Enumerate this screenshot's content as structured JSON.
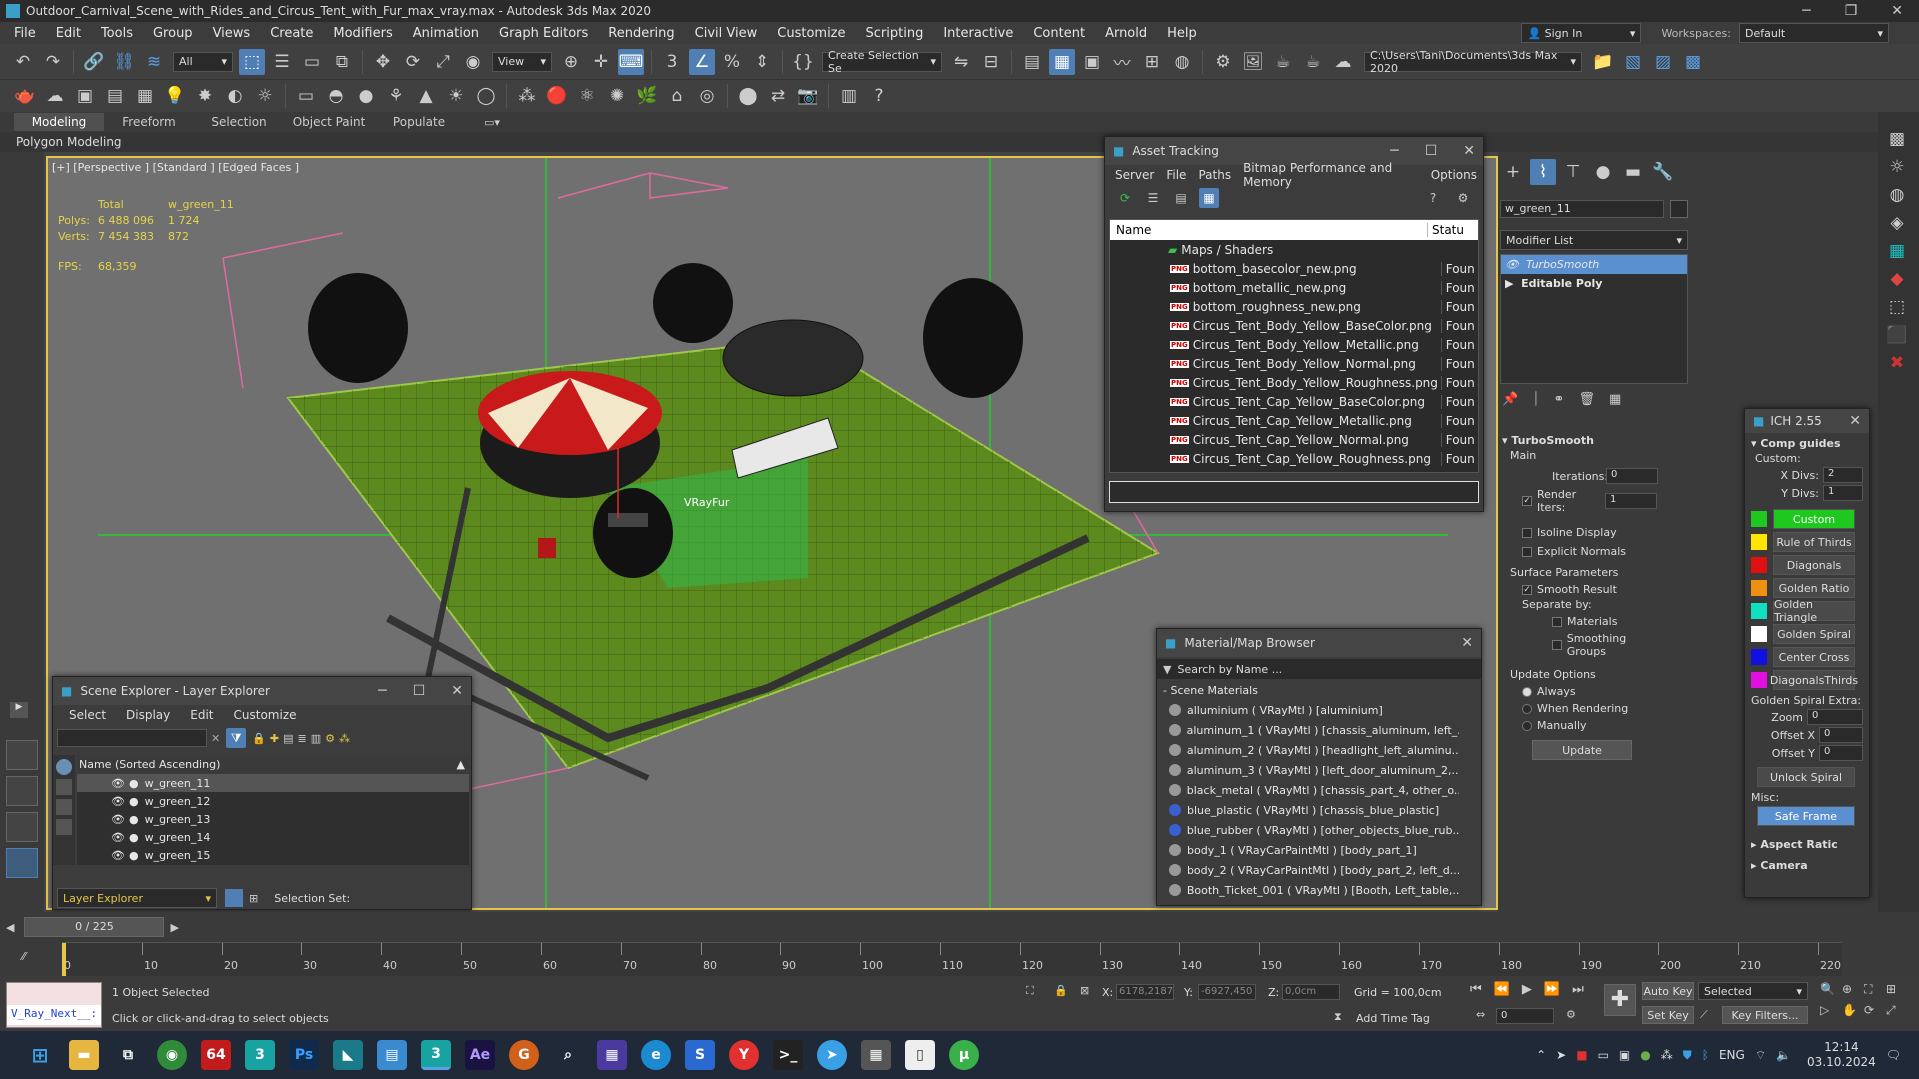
{
  "window": {
    "title": "Outdoor_Carnival_Scene_with_Rides_and_Circus_Tent_with_Fur_max_vray.max - Autodesk 3ds Max 2020"
  },
  "menu": [
    "File",
    "Edit",
    "Tools",
    "Group",
    "Views",
    "Create",
    "Modifiers",
    "Animation",
    "Graph Editors",
    "Rendering",
    "Civil View",
    "Customize",
    "Scripting",
    "Interactive",
    "Content",
    "Arnold",
    "Help"
  ],
  "account": {
    "sign_in": "Sign In",
    "workspaces_label": "Workspaces:",
    "workspace": "Default"
  },
  "toolbar": {
    "filter": "All",
    "ref_coord": "View",
    "selection_set": "Create Selection Se",
    "project_path": "C:\\Users\\Tani\\Documents\\3ds Max 2020"
  },
  "ribbon": {
    "tabs": [
      "Modeling",
      "Freeform",
      "Selection",
      "Object Paint",
      "Populate"
    ],
    "sub": "Polygon Modeling"
  },
  "viewport": {
    "label": "[+] [Perspective ] [Standard ] [Edged Faces ]",
    "stats": {
      "total_label": "Total",
      "object_label": "w_green_11",
      "polys_label": "Polys:",
      "polys_total": "6 488 096",
      "polys_obj": "1 724",
      "verts_label": "Verts:",
      "verts_total": "7 454 383",
      "verts_obj": "872",
      "fps_label": "FPS:",
      "fps": "68,359"
    },
    "vrayfur_label": "VRayFur"
  },
  "asset_tracking": {
    "title": "Asset Tracking",
    "menu": [
      "Server",
      "File",
      "Paths",
      "Bitmap Performance and Memory",
      "Options"
    ],
    "col_name": "Name",
    "col_status": "Statu",
    "group": "Maps / Shaders",
    "files": [
      "bottom_basecolor_new.png",
      "bottom_metallic_new.png",
      "bottom_roughness_new.png",
      "Circus_Tent_Body_Yellow_BaseColor.png",
      "Circus_Tent_Body_Yellow_Metallic.png",
      "Circus_Tent_Body_Yellow_Normal.png",
      "Circus_Tent_Body_Yellow_Roughness.png",
      "Circus_Tent_Cap_Yellow_BaseColor.png",
      "Circus_Tent_Cap_Yellow_Metallic.png",
      "Circus_Tent_Cap_Yellow_Normal.png",
      "Circus_Tent_Cap_Yellow_Roughness.png"
    ],
    "status": "Foun"
  },
  "material_browser": {
    "title": "Material/Map Browser",
    "search_placeholder": "Search by Name ...",
    "section": "Scene Materials",
    "items": [
      "alluminium ( VRayMtl ) [aluminium]",
      "aluminum_1 ( VRayMtl ) [chassis_aluminum, left_...",
      "aluminum_2 ( VRayMtl ) [headlight_left_aluminu...",
      "aluminum_3 ( VRayMtl ) [left_door_aluminum_2,...",
      "black_metal ( VRayMtl ) [chassis_part_4, other_o...",
      "blue_plastic ( VRayMtl ) [chassis_blue_plastic]",
      "blue_rubber ( VRayMtl ) [other_objects_blue_rub...",
      "body_1 ( VRayCarPaintMtl ) [body_part_1]",
      "body_2 ( VRayCarPaintMtl ) [body_part_2, left_d...",
      "Booth_Ticket_001 ( VRayMtl ) [Booth, Left_table,..."
    ]
  },
  "scene_explorer": {
    "title": "Scene Explorer - Layer Explorer",
    "menu": [
      "Select",
      "Display",
      "Edit",
      "Customize"
    ],
    "column": "Name (Sorted Ascending)",
    "rows": [
      "w_green_11",
      "w_green_12",
      "w_green_13",
      "w_green_14",
      "w_green_15"
    ],
    "footer_mode": "Layer Explorer",
    "selection_set": "Selection Set:"
  },
  "modify_panel": {
    "object_name": "w_green_11",
    "modifier_list": "Modifier List",
    "stack": [
      "TurboSmooth",
      "Editable Poly"
    ],
    "turbosmooth": {
      "title": "TurboSmooth",
      "main": "Main",
      "iterations_label": "Iterations:",
      "iterations": "0",
      "render_iters_label": "Render Iters:",
      "render_iters": "1",
      "isoline": "Isoline Display",
      "explicit": "Explicit Normals",
      "surface": "Surface Parameters",
      "smooth_result": "Smooth Result",
      "separate_by": "Separate by:",
      "materials": "Materials",
      "smoothing_groups": "Smoothing Groups",
      "update_options": "Update Options",
      "always": "Always",
      "when_rendering": "When Rendering",
      "manually": "Manually",
      "update_button": "Update"
    }
  },
  "ich": {
    "title": "ICH 2.55",
    "comp_guides": "Comp guides",
    "custom_label": "Custom:",
    "xdivs_label": "X Divs:",
    "xdivs": "2",
    "ydivs_label": "Y Divs:",
    "ydivs": "1",
    "guides": [
      {
        "name": "Custom",
        "color": "#1ec81e"
      },
      {
        "name": "Rule of Thirds",
        "color": "#ffe600"
      },
      {
        "name": "Diagonals",
        "color": "#e01010"
      },
      {
        "name": "Golden Ratio",
        "color": "#f09010"
      },
      {
        "name": "Golden Triangle",
        "color": "#10e0c0"
      },
      {
        "name": "Golden Spiral",
        "color": "#ffffff"
      },
      {
        "name": "Center Cross",
        "color": "#1010e0"
      },
      {
        "name": "DiagonalsThirds",
        "color": "#e010e0"
      }
    ],
    "spiral_extra": "Golden Spiral Extra:",
    "zoom_label": "Zoom",
    "zoom": "0",
    "offx_label": "Offset X",
    "offx": "0",
    "offy_label": "Offset Y",
    "offy": "0",
    "unlock": "Unlock Spiral",
    "misc": "Misc:",
    "safe_frame": "Safe Frame",
    "aspect": "Aspect Ratic",
    "camera": "Camera"
  },
  "timeline": {
    "frame": "0 / 225",
    "ticks": [
      "0",
      "10",
      "20",
      "30",
      "40",
      "50",
      "60",
      "70",
      "80",
      "90",
      "100",
      "110",
      "120",
      "130",
      "140",
      "150",
      "160",
      "170",
      "180",
      "190",
      "200",
      "210",
      "220"
    ]
  },
  "status": {
    "maxscript": "V_Ray_Next__:",
    "selected": "1 Object Selected",
    "prompt": "Click or click-and-drag to select objects",
    "x_label": "X:",
    "x": "6178,2187",
    "y_label": "Y:",
    "y": "-6927,450",
    "z_label": "Z:",
    "z": "0,0cm",
    "grid": "Grid = 100,0cm",
    "add_time_tag": "Add Time Tag",
    "auto_key": "Auto Key",
    "set_key": "Set Key",
    "selected_dd": "Selected",
    "key_filters": "Key Filters...",
    "frame_value": "0"
  },
  "taskbar": {
    "lang": "ENG",
    "time": "12:14",
    "date": "03.10.2024",
    "badge": "64"
  }
}
